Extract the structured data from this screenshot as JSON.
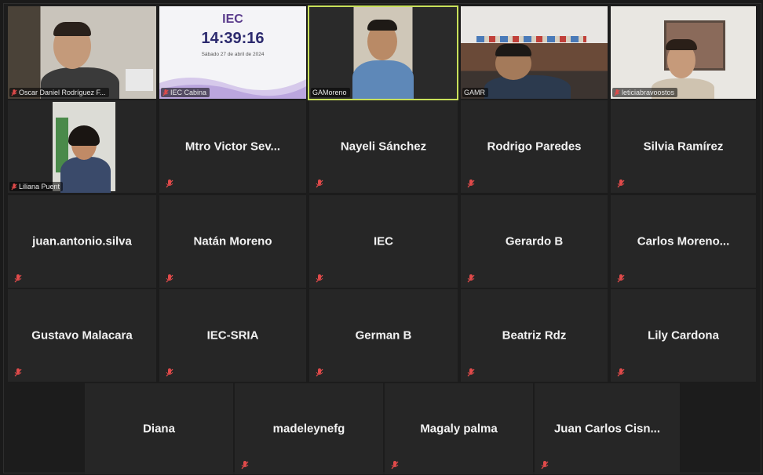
{
  "colors": {
    "tile_bg": "#262626",
    "active_border": "#c8e05a",
    "mic_muted": "#e04a4a",
    "name_text": "#f2f2f2"
  },
  "video_tiles": [
    {
      "name": "Oscar Daniel Rodríguez F...",
      "muted": true
    },
    {
      "name": "IEC Cabina",
      "muted": true,
      "screen": {
        "logo": "IEC",
        "time": "14:39:16",
        "date": "Sábado 27 de abril de 2024"
      }
    },
    {
      "name": "GAMoreno",
      "muted": false,
      "active": true
    },
    {
      "name": "GAMR",
      "muted": false
    },
    {
      "name": "leticiabravoostos",
      "muted": true
    },
    {
      "name": "Liliana Puent",
      "muted": true
    }
  ],
  "name_tiles": [
    {
      "name": "Mtro Victor Sev...",
      "muted": true
    },
    {
      "name": "Nayeli Sánchez",
      "muted": true
    },
    {
      "name": "Rodrigo Paredes",
      "muted": true
    },
    {
      "name": "Silvia Ramírez",
      "muted": true
    },
    {
      "name": "juan.antonio.silva",
      "muted": true
    },
    {
      "name": "Natán Moreno",
      "muted": true
    },
    {
      "name": "IEC",
      "muted": true
    },
    {
      "name": "Gerardo B",
      "muted": true
    },
    {
      "name": "Carlos  Moreno...",
      "muted": true
    },
    {
      "name": "Gustavo Malacara",
      "muted": true
    },
    {
      "name": "IEC-SRIA",
      "muted": true
    },
    {
      "name": "German B",
      "muted": true
    },
    {
      "name": "Beatriz Rdz",
      "muted": true
    },
    {
      "name": "Lily Cardona",
      "muted": true
    },
    {
      "name": "Diana",
      "muted": false
    },
    {
      "name": "madeleynefg",
      "muted": true
    },
    {
      "name": "Magaly palma",
      "muted": true
    },
    {
      "name": "Juan  Carlos Cisn...",
      "muted": true
    }
  ]
}
